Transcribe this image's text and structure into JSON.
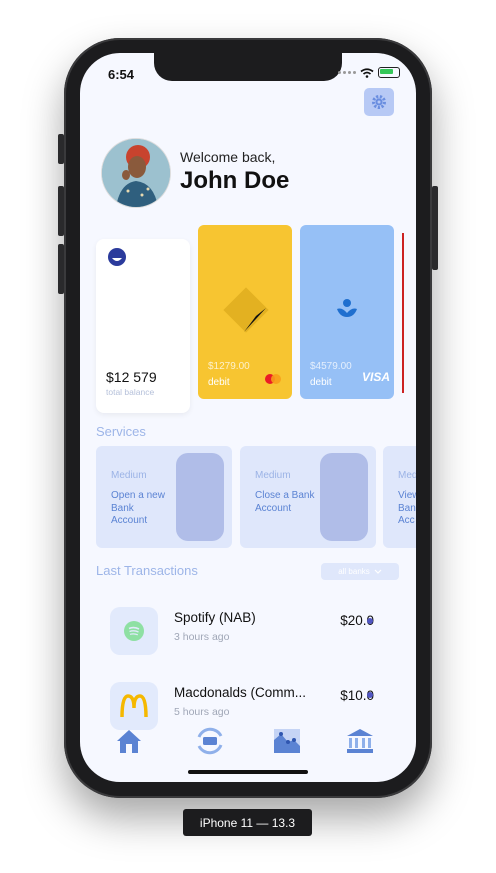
{
  "status": {
    "time": "6:54"
  },
  "header": {
    "welcome": "Welcome back,",
    "name": "John Doe"
  },
  "cards": {
    "summary": {
      "amount": "$12 579",
      "label": "total balance"
    },
    "items": [
      {
        "amount": "$1279.00",
        "type": "debit",
        "network": "mastercard",
        "color": "#f7c531"
      },
      {
        "amount": "$4579.00",
        "type": "debit",
        "network": "VISA",
        "color": "#96c0f6"
      }
    ]
  },
  "services": {
    "title": "Services",
    "items": [
      {
        "tag": "Medium",
        "label": "Open a new Bank Account"
      },
      {
        "tag": "Medium",
        "label": "Close a Bank Account"
      },
      {
        "tag": "Med",
        "label": "View Bank Acc"
      }
    ]
  },
  "transactions": {
    "title": "Last Transactions",
    "filter": "all banks",
    "items": [
      {
        "title": "Spotify (NAB)",
        "time": "3 hours ago",
        "amount": "$20.0",
        "icon": "spotify-icon"
      },
      {
        "title": "Macdonalds (Comm...",
        "time": "5 hours ago",
        "amount": "$10.0",
        "icon": "mcdonalds-icon"
      }
    ]
  },
  "tabs": [
    "home-icon",
    "exchange-icon",
    "chart-icon",
    "bank-icon"
  ],
  "device": {
    "caption": "iPhone 11 — 13.3"
  },
  "colors": {
    "accent": "#5b83d3",
    "yellow": "#f7c531",
    "blue": "#96c0f6"
  }
}
